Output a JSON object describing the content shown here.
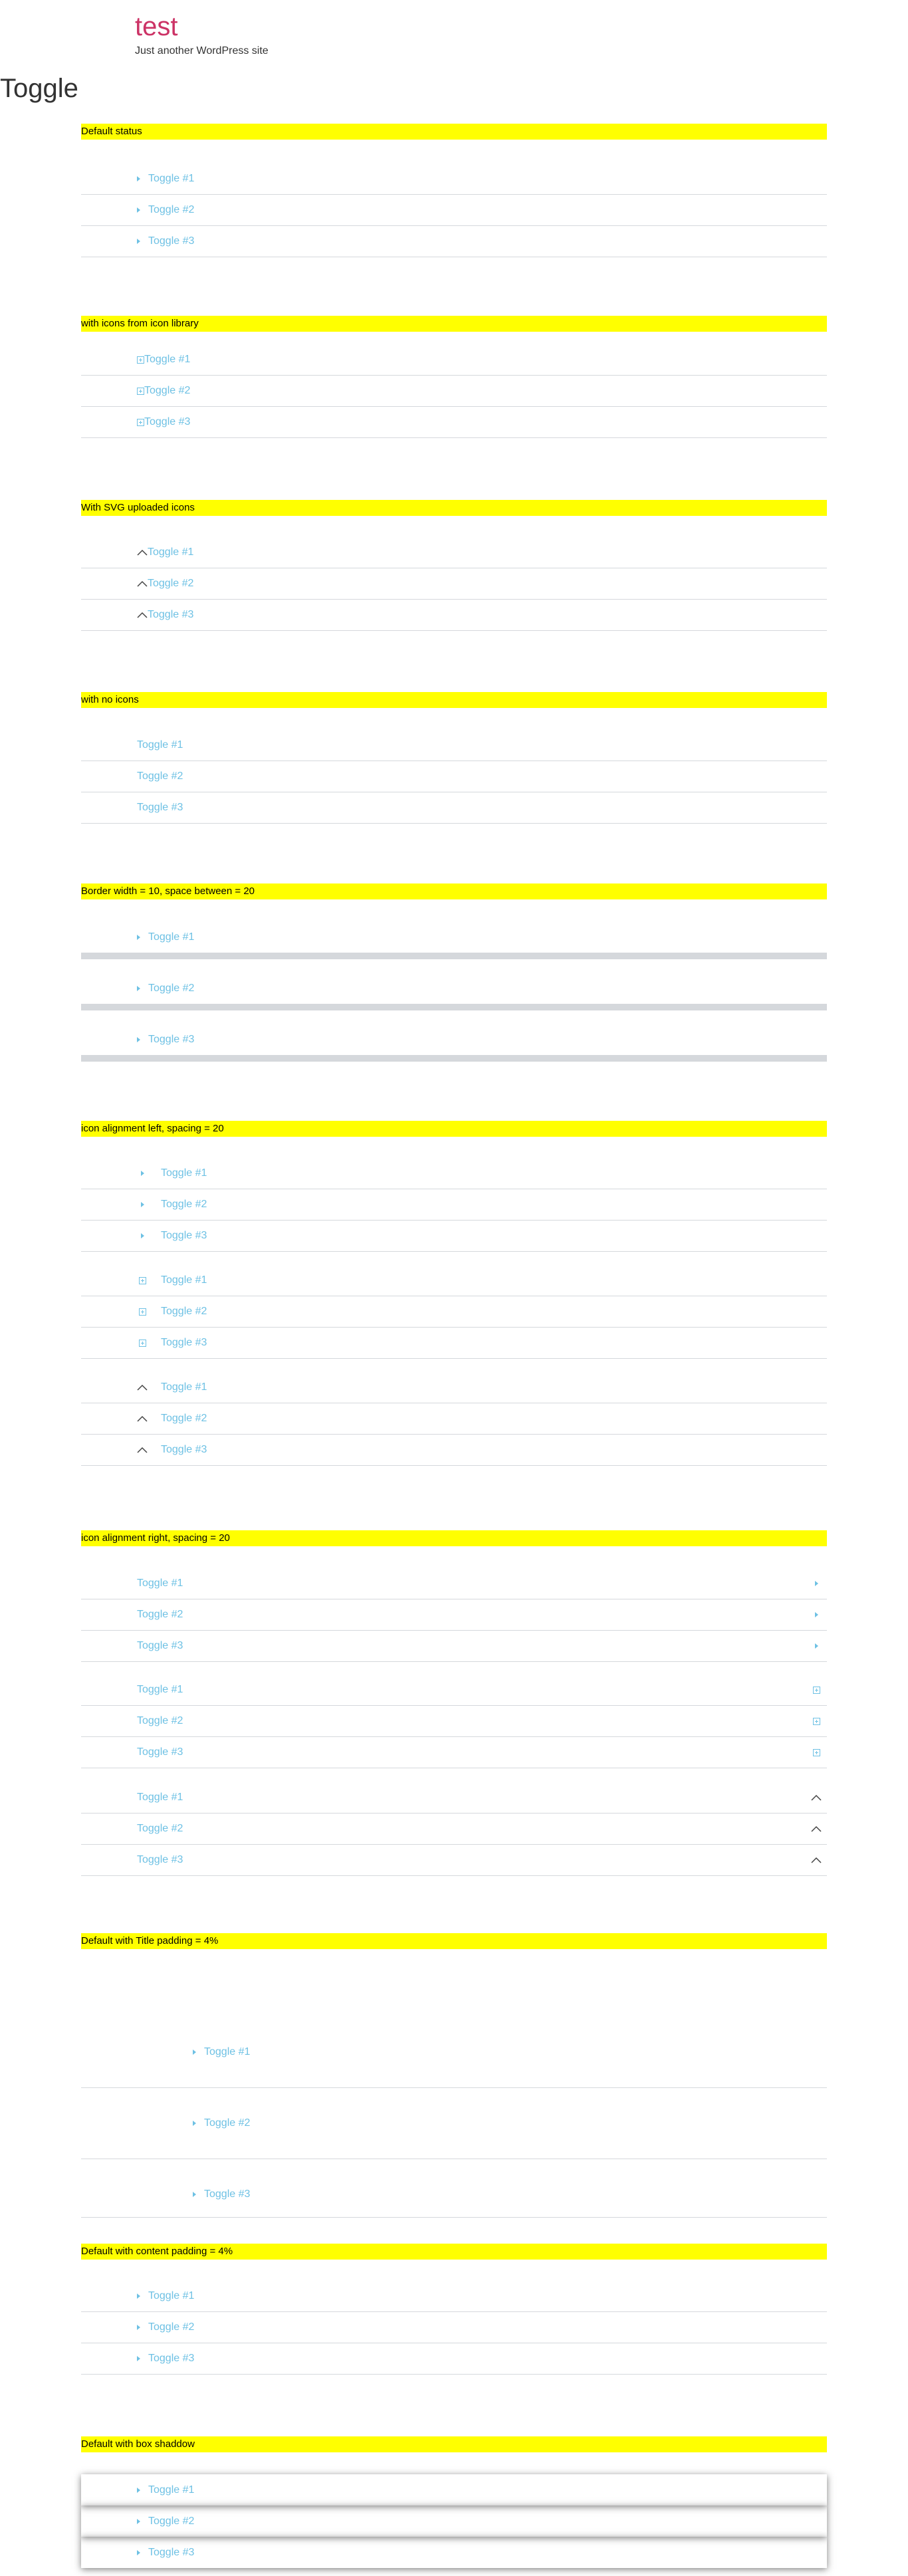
{
  "site": {
    "title": "test",
    "description": "Just another WordPress site"
  },
  "page": {
    "title": "Toggle"
  },
  "colors": {
    "accent": "#6ec1e4",
    "brand": "#cc3366",
    "highlight": "#ffff00",
    "border": "#d5d8dc"
  },
  "sections": {
    "s1": {
      "heading": "Default status",
      "items": [
        "Toggle #1",
        "Toggle #2",
        "Toggle #3"
      ]
    },
    "s2": {
      "heading": "with icons from icon library",
      "items": [
        "Toggle #1",
        "Toggle #2",
        "Toggle #3"
      ]
    },
    "s3": {
      "heading": "With SVG uploaded icons",
      "items": [
        "Toggle #1",
        "Toggle #2",
        "Toggle #3"
      ]
    },
    "s4": {
      "heading": "with no icons",
      "items": [
        "Toggle #1",
        "Toggle #2",
        "Toggle #3"
      ]
    },
    "s5": {
      "heading": "Border width = 10, space between = 20",
      "items": [
        "Toggle #1",
        "Toggle #2",
        "Toggle #3"
      ]
    },
    "s6": {
      "heading": "icon alignment left, spacing = 20",
      "items": [
        "Toggle #1",
        "Toggle #2",
        "Toggle #3"
      ]
    },
    "s7": {
      "heading": "icon alignment right, spacing = 20",
      "items": [
        "Toggle #1",
        "Toggle #2",
        "Toggle #3"
      ]
    },
    "s8": {
      "heading": "Default with Title padding = 4%",
      "items": [
        "Toggle #1",
        "Toggle #2",
        "Toggle #3"
      ]
    },
    "s9": {
      "heading": "Default with content padding = 4%",
      "items": [
        "Toggle #1",
        "Toggle #2",
        "Toggle #3"
      ]
    },
    "s10": {
      "heading": "Default with box shaddow",
      "items": [
        "Toggle #1",
        "Toggle #2",
        "Toggle #3"
      ]
    }
  },
  "icons": {
    "caret": "caret-right-icon",
    "plus": "plus-square-icon",
    "chevron": "chevron-up-icon"
  }
}
